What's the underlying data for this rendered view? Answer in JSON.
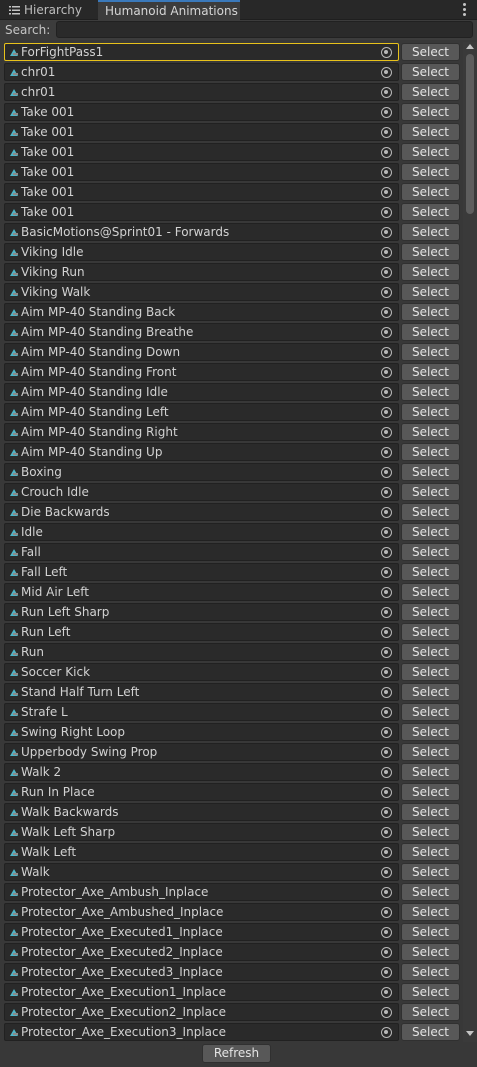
{
  "tabs": {
    "hierarchy": "Hierarchy",
    "humanoid": "Humanoid Animations"
  },
  "search": {
    "label": "Search:",
    "value": ""
  },
  "select_label": "Select",
  "refresh_label": "Refresh",
  "colors": {
    "accent_selected": "#e8c21b",
    "tab_active": "#3a79bb",
    "icon": "#4fb5c7"
  },
  "items": [
    "ForFightPass1",
    "chr01",
    "chr01",
    "Take 001",
    "Take 001",
    "Take 001",
    "Take 001",
    "Take 001",
    "Take 001",
    "BasicMotions@Sprint01 - Forwards",
    "Viking Idle",
    "Viking Run",
    "Viking Walk",
    "Aim MP-40 Standing Back",
    "Aim MP-40 Standing Breathe",
    "Aim MP-40 Standing Down",
    "Aim MP-40 Standing Front",
    "Aim MP-40 Standing Idle",
    "Aim MP-40 Standing Left",
    "Aim MP-40 Standing Right",
    "Aim MP-40 Standing Up",
    "Boxing",
    "Crouch Idle",
    "Die Backwards",
    "Idle",
    "Fall",
    "Fall Left",
    "Mid Air Left",
    "Run Left Sharp",
    "Run Left",
    "Run",
    "Soccer Kick",
    "Stand Half Turn Left",
    "Strafe L",
    "Swing Right Loop",
    "Upperbody Swing Prop",
    "Walk 2",
    "Run In Place",
    "Walk Backwards",
    "Walk Left Sharp",
    "Walk Left",
    "Walk",
    "Protector_Axe_Ambush_Inplace",
    "Protector_Axe_Ambushed_Inplace",
    "Protector_Axe_Executed1_Inplace",
    "Protector_Axe_Executed2_Inplace",
    "Protector_Axe_Executed3_Inplace",
    "Protector_Axe_Execution1_Inplace",
    "Protector_Axe_Execution2_Inplace",
    "Protector_Axe_Execution3_Inplace"
  ]
}
